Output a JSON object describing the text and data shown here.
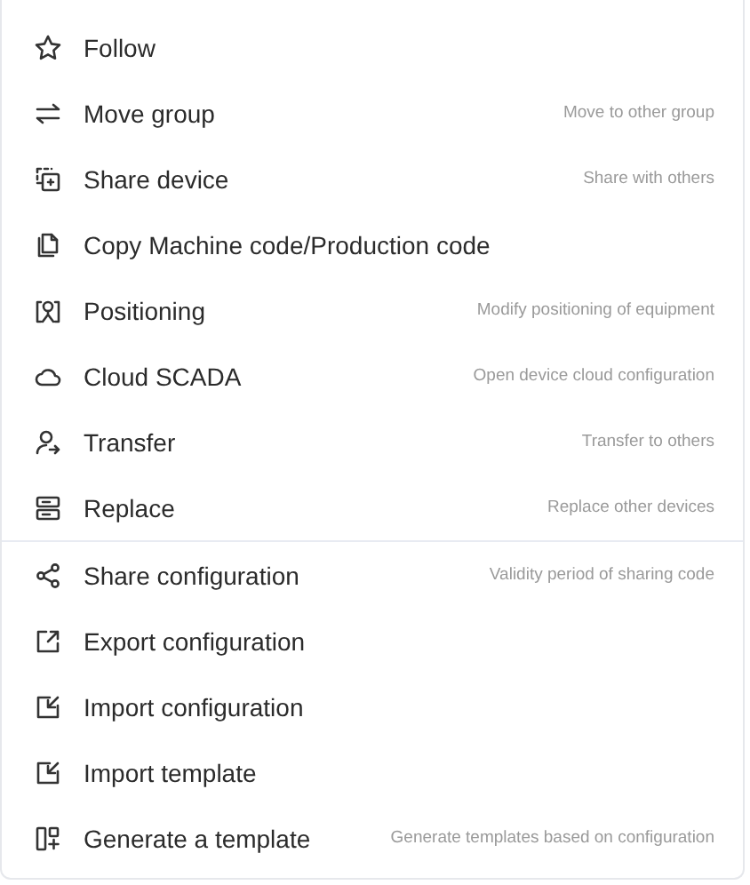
{
  "menu": {
    "groups": [
      {
        "items": [
          {
            "label": "Follow"
          },
          {
            "label": "Move group",
            "description": "Move to other group"
          },
          {
            "label": "Share device",
            "description": "Share with others"
          },
          {
            "label": "Copy Machine code/Production code"
          },
          {
            "label": "Positioning",
            "description": "Modify positioning of equipment"
          },
          {
            "label": "Cloud SCADA",
            "description": "Open device cloud configuration"
          },
          {
            "label": "Transfer",
            "description": "Transfer to others"
          },
          {
            "label": "Replace",
            "description": "Replace other devices"
          }
        ]
      },
      {
        "items": [
          {
            "label": "Share configuration",
            "description": "Validity period of sharing code"
          },
          {
            "label": "Export configuration"
          },
          {
            "label": "Import configuration"
          },
          {
            "label": "Import template"
          },
          {
            "label": "Generate a template",
            "description": "Generate templates based on configuration"
          }
        ]
      }
    ]
  }
}
